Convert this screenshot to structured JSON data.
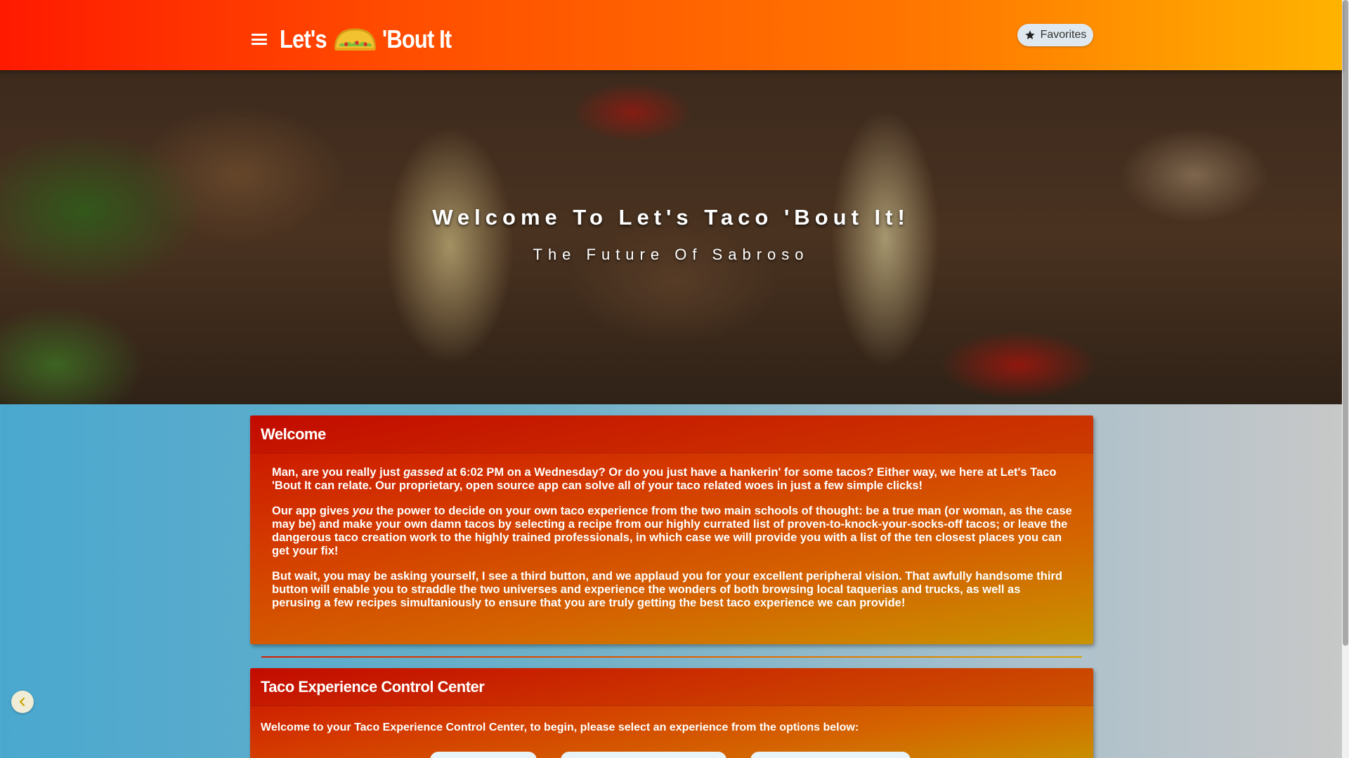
{
  "brand": {
    "part1": "Let's",
    "part2": "'Bout It",
    "icon": "taco-icon"
  },
  "nav": {
    "menu_icon": "hamburger-menu-icon",
    "favorites_label": "Favorites",
    "favorites_icon": "star-icon"
  },
  "hero": {
    "title": "Welcome To Let's Taco 'Bout It!",
    "subtitle": "The Future Of Sabroso"
  },
  "welcome_card": {
    "header": "Welcome",
    "p1_a": "Man, are you really just ",
    "p1_em": "gassed",
    "p1_b": " at 6:02 PM on a Wednesday? Or do you just have a hankerin' for some tacos? Either way, we here at Let's Taco 'Bout It can relate. Our proprietary, open source app can solve all of your taco related woes in just a few simple clicks!",
    "p2_a": "Our app gives ",
    "p2_em": "you",
    "p2_b": " the power to decide on your own taco experience from the two main schools of thought: be a true man (or woman, as the case may be) and make your own damn tacos by selecting a recipe from our highly currated list of proven-to-knock-your-socks-off tacos; or leave the dangerous taco creation work to the highly trained professionals, in which case we will provide you with a list of the ten closest places you can get your fix!",
    "p3": "But wait, you may be asking yourself, I see a third button, and we applaud you for your excellent peripheral vision. That awfully handsome third button will enable you to straddle the two universes and experience the wonders of both browsing local taquerias and trucks, as well as perusing a few recipes simultaniously to ensure that you are truly getting the best taco experience we can provide!"
  },
  "control_card": {
    "header": "Taco Experience Control Center",
    "intro": "Welcome to your Taco Experience Control Center, to begin, please select an experience from the options below:",
    "options": [
      "",
      "",
      ""
    ]
  },
  "back_button": {
    "icon": "chevron-left-icon"
  },
  "colors": {
    "nav_start": "#ff1a00",
    "nav_end": "#ffb300",
    "card_start": "#c90e00",
    "card_end": "#c89300",
    "page_bg_left": "#4aa8cf"
  }
}
